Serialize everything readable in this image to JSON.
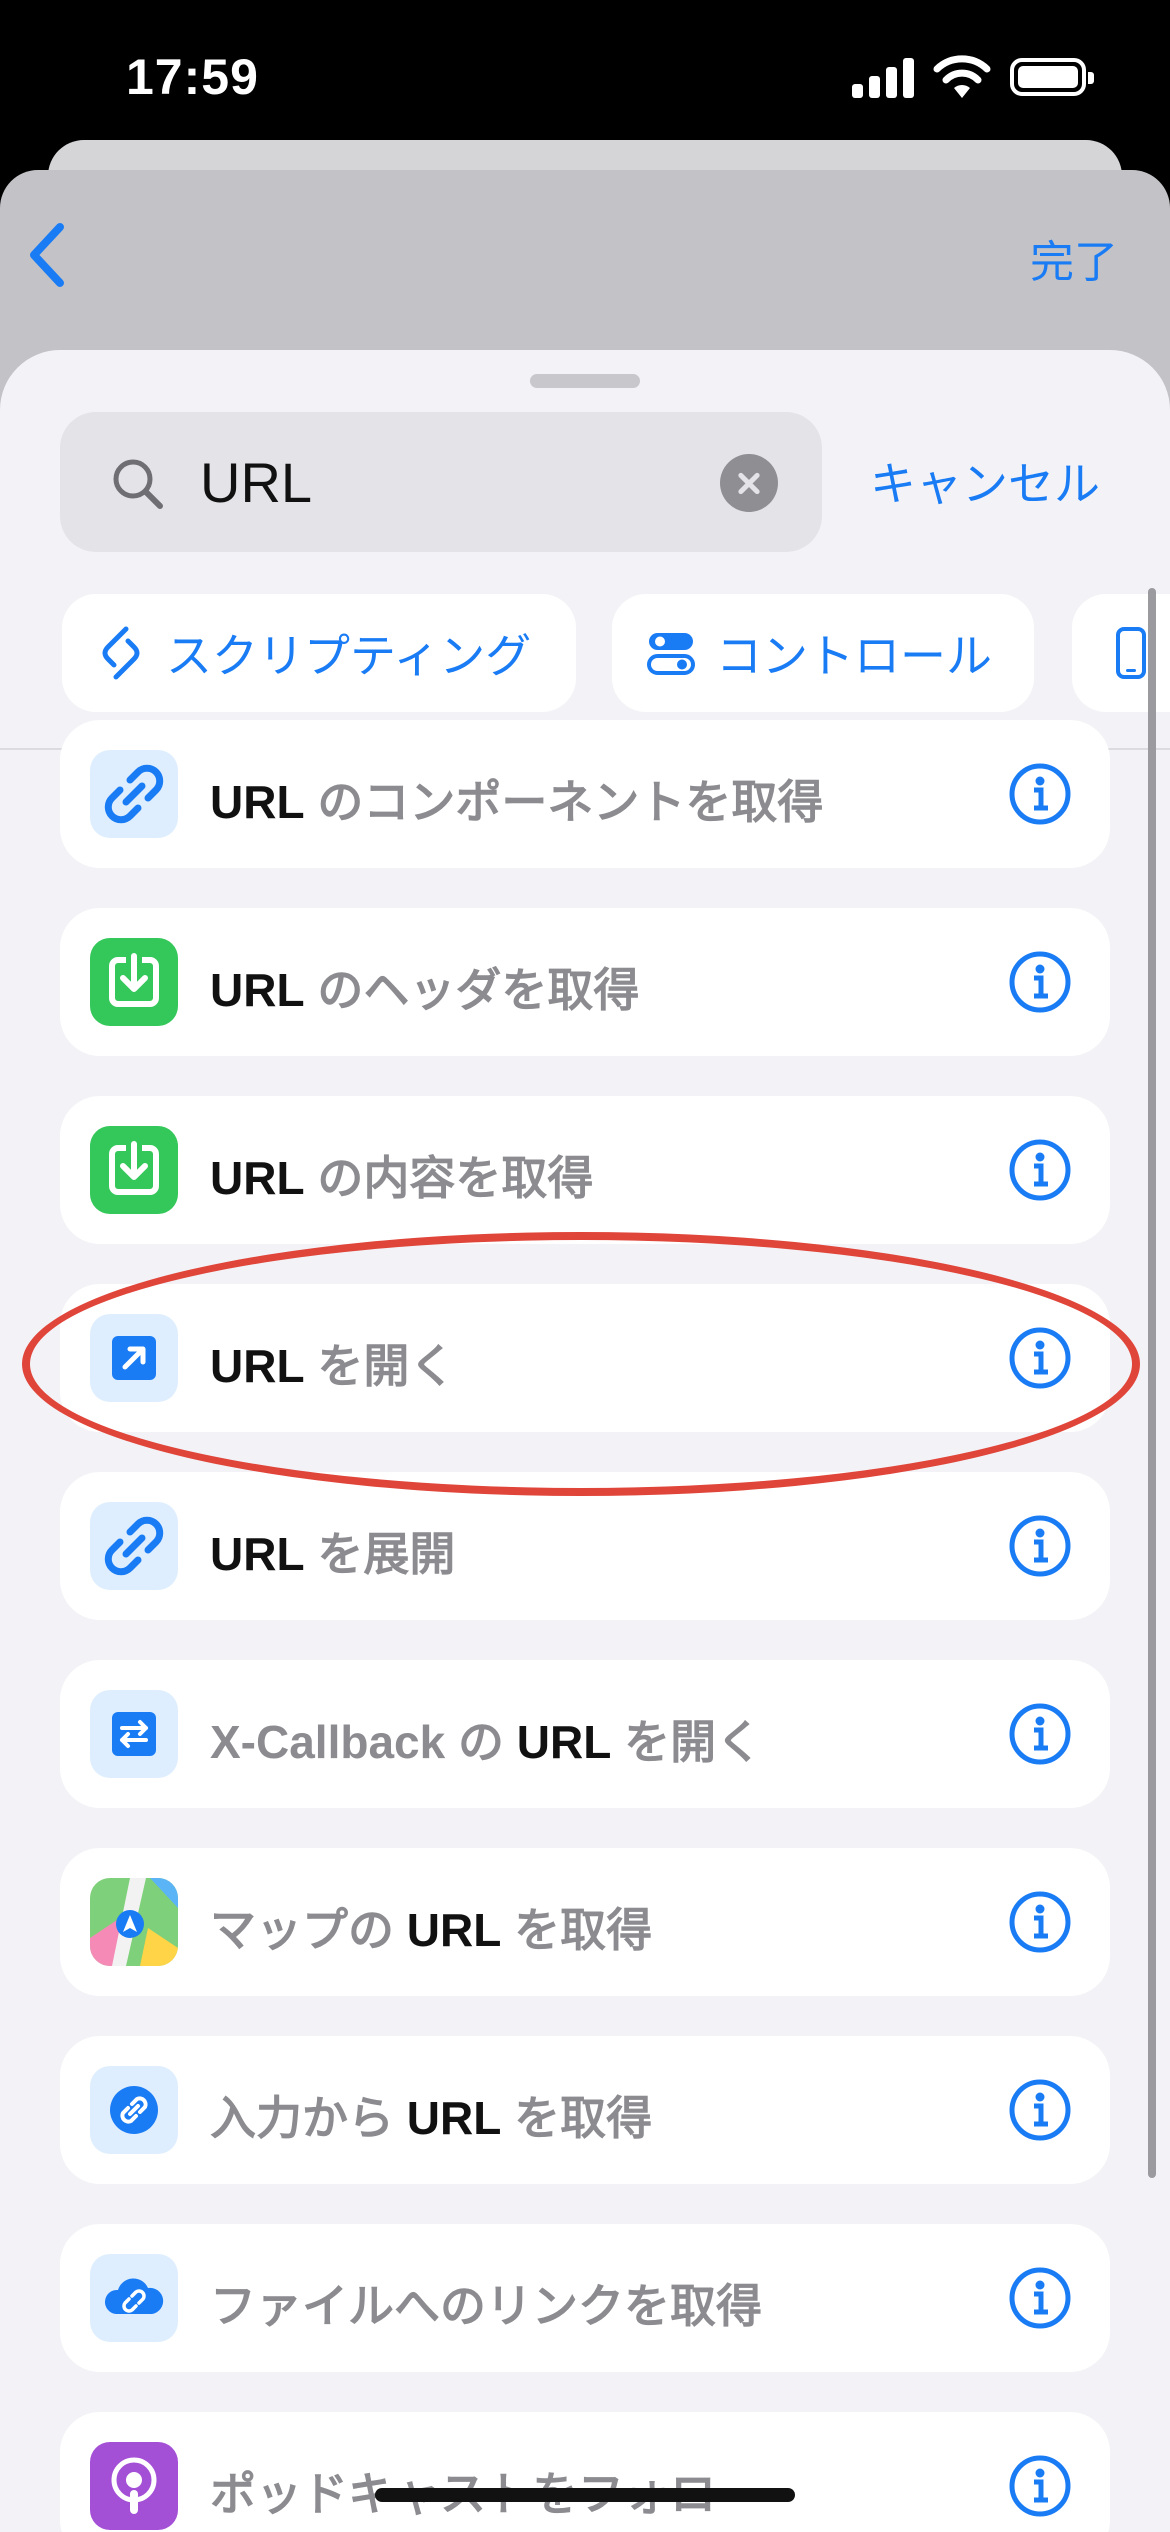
{
  "status": {
    "time": "17:59"
  },
  "nav": {
    "done_label": "完了"
  },
  "search": {
    "query": "URL",
    "cancel_label": "キャンセル"
  },
  "chips": [
    {
      "label": "スクリプティング",
      "icon": "scripting-icon"
    },
    {
      "label": "コントロール",
      "icon": "toggle-icon"
    },
    {
      "label": "",
      "icon": "phone-icon"
    }
  ],
  "actions": [
    {
      "pre": "",
      "bold": "URL",
      "post": " のコンポーネントを取得",
      "icon": "link-icon",
      "icon_bg": "#dfeefe"
    },
    {
      "pre": "",
      "bold": "URL",
      "post": " のヘッダを取得",
      "icon": "download-icon",
      "icon_bg": "#34c759"
    },
    {
      "pre": "",
      "bold": "URL",
      "post": " の内容を取得",
      "icon": "download-icon",
      "icon_bg": "#34c759"
    },
    {
      "pre": "",
      "bold": "URL",
      "post": " を開く",
      "icon": "open-arrow-icon",
      "icon_bg": "#dfeefe"
    },
    {
      "pre": "",
      "bold": "URL",
      "post": " を展開",
      "icon": "link-icon",
      "icon_bg": "#dfeefe"
    },
    {
      "pre": "X-Callback の ",
      "bold": "URL",
      "post": " を開く",
      "icon": "swap-arrows-icon",
      "icon_bg": "#dfeefe"
    },
    {
      "pre": "マップの ",
      "bold": "URL",
      "post": " を取得",
      "icon": "maps-icon",
      "icon_bg": "#7fd07a"
    },
    {
      "pre": "入力から ",
      "bold": "URL",
      "post": " を取得",
      "icon": "link-circle-icon",
      "icon_bg": "#dfeefe"
    },
    {
      "pre": "ファイルへのリンクを取得",
      "bold": "",
      "post": "",
      "icon": "cloud-link-icon",
      "icon_bg": "#dfeefe"
    },
    {
      "pre": "ポッドキャストをフォロー",
      "bold": "",
      "post": "",
      "icon": "podcast-icon",
      "icon_bg": "#a34fd6"
    }
  ],
  "colors": {
    "accent": "#1a7cf5",
    "highlight": "#e0453a"
  }
}
